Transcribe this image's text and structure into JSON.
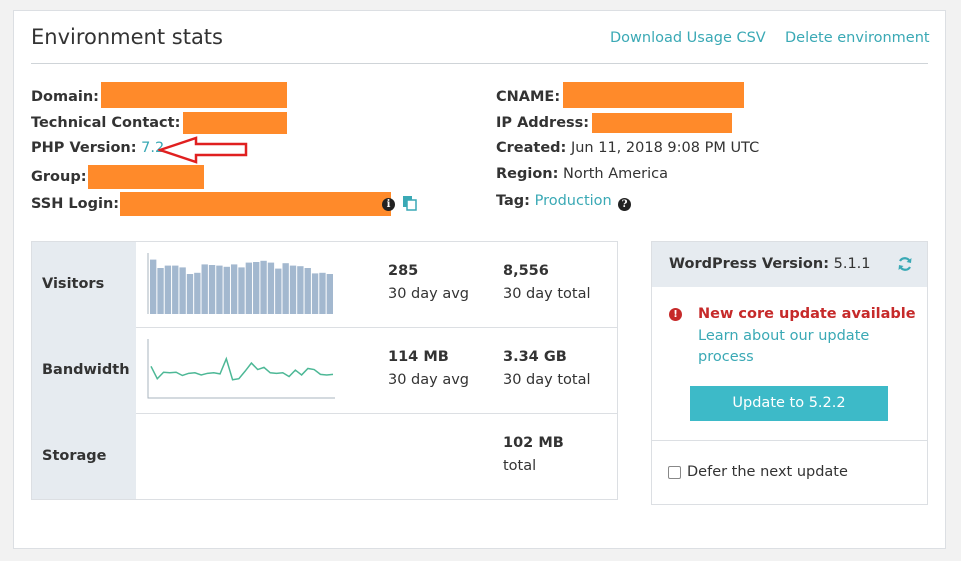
{
  "header": {
    "title": "Environment stats",
    "download_csv": "Download Usage CSV",
    "delete_env": "Delete environment"
  },
  "details_left": {
    "domain_label": "Domain:",
    "tech_contact_label": "Technical Contact:",
    "php_label": "PHP Version:",
    "php_value": "7.2",
    "group_label": "Group:",
    "ssh_label": "SSH Login:"
  },
  "details_right": {
    "cname_label": "CNAME:",
    "ip_label": "IP Address:",
    "created_label": "Created:",
    "created_value": "Jun 11, 2018 9:08 PM UTC",
    "region_label": "Region:",
    "region_value": "North America",
    "tag_label": "Tag:",
    "tag_value": "Production"
  },
  "stats": {
    "rows": [
      {
        "label": "Visitors",
        "avg_value": "285",
        "avg_caption": "30 day avg",
        "total_value": "8,556",
        "total_caption": "30 day total"
      },
      {
        "label": "Bandwidth",
        "avg_value": "114 MB",
        "avg_caption": "30 day avg",
        "total_value": "3.34 GB",
        "total_caption": "30 day total"
      },
      {
        "label": "Storage",
        "total_value": "102 MB",
        "total_caption": "total"
      }
    ],
    "visitors_sparkline": [
      0.74,
      0.6,
      0.64,
      0.64,
      0.61,
      0.5,
      0.52,
      0.66,
      0.65,
      0.64,
      0.62,
      0.66,
      0.61,
      0.69,
      0.7,
      0.72,
      0.69,
      0.59,
      0.68,
      0.64,
      0.63,
      0.6,
      0.51,
      0.52,
      0.5
    ],
    "bandwidth_sparkline": [
      0.55,
      0.32,
      0.44,
      0.43,
      0.44,
      0.38,
      0.42,
      0.43,
      0.39,
      0.42,
      0.43,
      0.41,
      0.69,
      0.3,
      0.32,
      0.46,
      0.61,
      0.49,
      0.53,
      0.43,
      0.42,
      0.43,
      0.36,
      0.48,
      0.39,
      0.51,
      0.49,
      0.4,
      0.39,
      0.4
    ],
    "chart_color": "#4db896",
    "bar_color": "#a3b8cf"
  },
  "wordpress": {
    "version_label": "WordPress Version:",
    "version_value": "5.1.1",
    "alert_title": "New core update available",
    "alert_link": "Learn about our update process",
    "update_button": "Update to 5.2.2",
    "defer_label": "Defer the next update",
    "defer_checked": false
  },
  "annotation": {
    "arrow_color": "#e02020"
  },
  "colors": {
    "accent": "#3aa9b5",
    "button": "#3dbac8",
    "alert": "#c62a2a",
    "redaction": "#ff8a2a"
  }
}
